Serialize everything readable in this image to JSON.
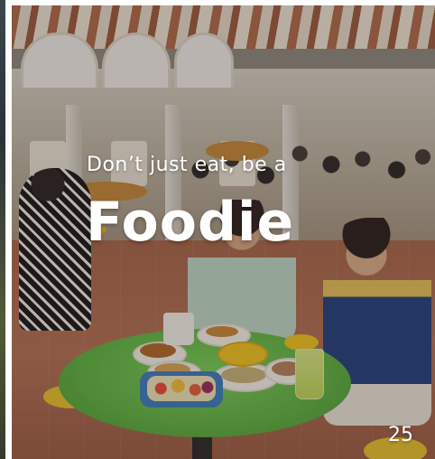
{
  "slide": {
    "tagline": "Don’t just eat, be a",
    "headline": "Foodie",
    "page_number": "25"
  },
  "colors": {
    "text": "#ffffff",
    "table_green": "#5fb544",
    "stool_yellow": "#e8c22f",
    "floor_terracotta": "#a8674b"
  }
}
